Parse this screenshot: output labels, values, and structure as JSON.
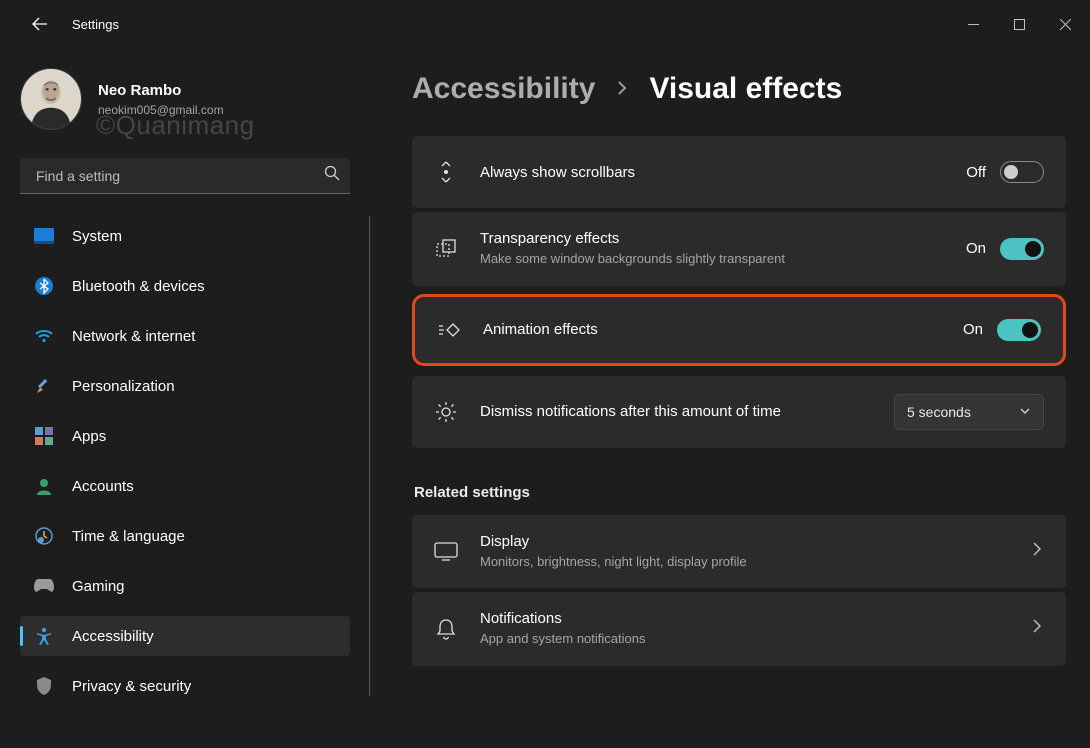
{
  "window": {
    "app_title": "Settings"
  },
  "user": {
    "name": "Neo Rambo",
    "email": "neokim005@gmail.com"
  },
  "search": {
    "placeholder": "Find a setting"
  },
  "sidebar": {
    "items": [
      {
        "label": "System"
      },
      {
        "label": "Bluetooth & devices"
      },
      {
        "label": "Network & internet"
      },
      {
        "label": "Personalization"
      },
      {
        "label": "Apps"
      },
      {
        "label": "Accounts"
      },
      {
        "label": "Time & language"
      },
      {
        "label": "Gaming"
      },
      {
        "label": "Accessibility"
      },
      {
        "label": "Privacy & security"
      }
    ],
    "active_index": 8
  },
  "breadcrumb": {
    "parent": "Accessibility",
    "current": "Visual effects"
  },
  "settings": {
    "scrollbars": {
      "title": "Always show scrollbars",
      "state_label": "Off",
      "on": false
    },
    "transparency": {
      "title": "Transparency effects",
      "sub": "Make some window backgrounds slightly transparent",
      "state_label": "On",
      "on": true
    },
    "animation": {
      "title": "Animation effects",
      "state_label": "On",
      "on": true
    },
    "dismiss": {
      "title": "Dismiss notifications after this amount of time",
      "value": "5 seconds"
    }
  },
  "related": {
    "heading": "Related settings",
    "display": {
      "title": "Display",
      "sub": "Monitors, brightness, night light, display profile"
    },
    "notifications": {
      "title": "Notifications",
      "sub": "App and system notifications"
    }
  },
  "watermark": "©Quanimang"
}
